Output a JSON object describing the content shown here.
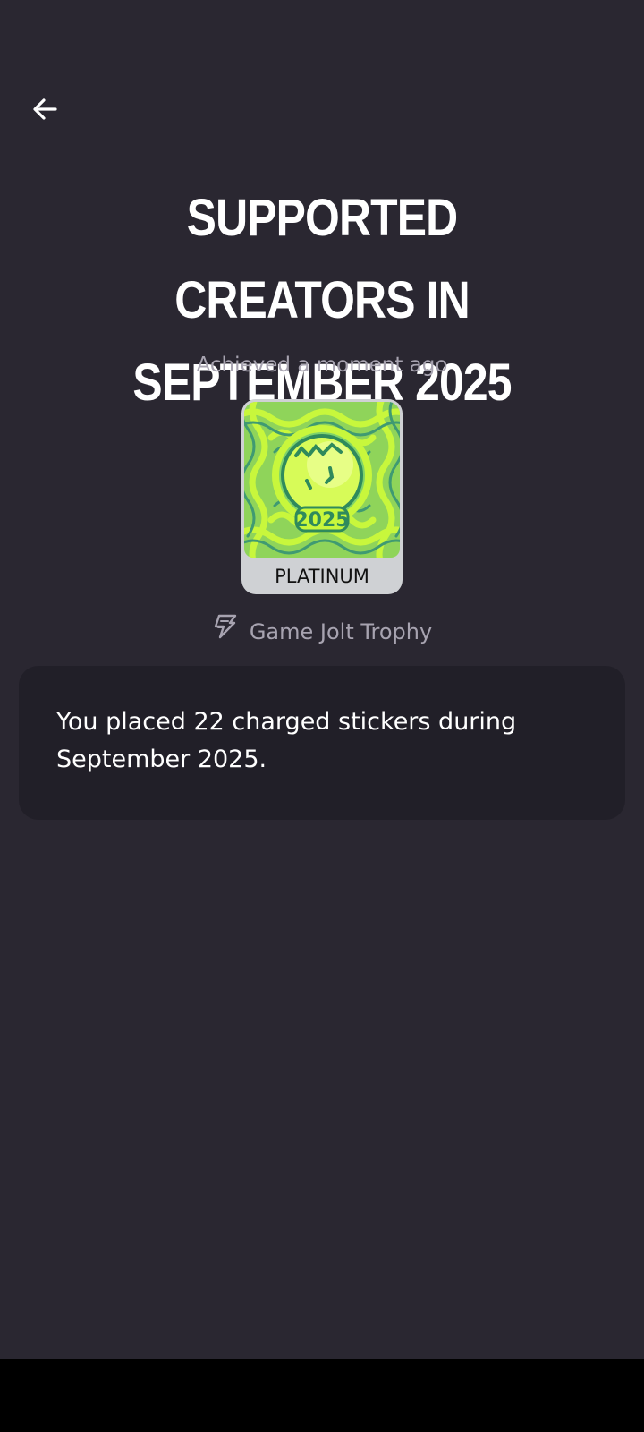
{
  "header": {
    "back_icon": "arrow-left-icon",
    "title": "SUPPORTED CREATORS IN SEPTEMBER 2025"
  },
  "trophy": {
    "achieved_text": "Achieved a moment ago",
    "tier_label": "PLATINUM",
    "art_year": "2025",
    "accent_color": "#b9f23a"
  },
  "source": {
    "icon": "game-jolt-bolt-icon",
    "label": "Game Jolt Trophy"
  },
  "description": {
    "text": "You placed 22 charged stickers during September 2025."
  },
  "colors": {
    "background": "#2a2731",
    "card": "#211f28",
    "muted_text": "#a7a3b0"
  }
}
